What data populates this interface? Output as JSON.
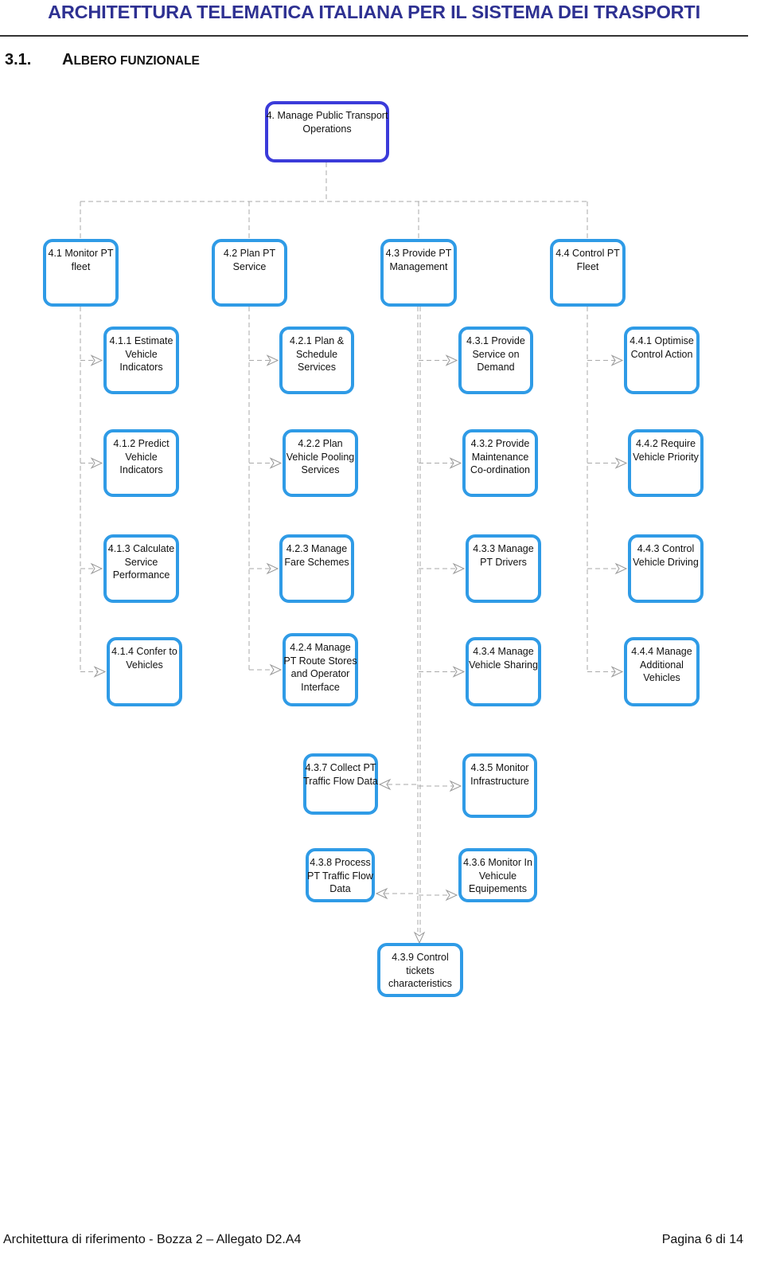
{
  "header": {
    "title": "ARCHITETTURA TELEMATICA ITALIANA PER IL SISTEMA DEI TRASPORTI"
  },
  "section": {
    "number": "3.1.",
    "title_initial": "A",
    "title_rest": "LBERO FUNZIONALE"
  },
  "colors": {
    "header_text": "#2e3192",
    "root_border": "#3b3bd9",
    "node_border": "#2f9be6",
    "connector": "#aaaaaa"
  },
  "tree": {
    "root": {
      "id": "4",
      "label": "4. Manage Public Transport Operations"
    },
    "nodes": [
      {
        "id": "4.1",
        "label": "4.1 Monitor PT fleet"
      },
      {
        "id": "4.2",
        "label": "4.2 Plan PT Service"
      },
      {
        "id": "4.3",
        "label": "4.3 Provide PT Management"
      },
      {
        "id": "4.4",
        "label": "4.4 Control PT Fleet"
      },
      {
        "id": "4.1.1",
        "label": "4.1.1 Estimate Vehicle Indicators"
      },
      {
        "id": "4.2.1",
        "label": "4.2.1 Plan & Schedule Services"
      },
      {
        "id": "4.3.1",
        "label": "4.3.1 Provide Service on Demand"
      },
      {
        "id": "4.4.1",
        "label": "4.4.1 Optimise Control Action"
      },
      {
        "id": "4.1.2",
        "label": "4.1.2 Predict Vehicle Indicators"
      },
      {
        "id": "4.2.2",
        "label": "4.2.2 Plan Vehicle Pooling Services"
      },
      {
        "id": "4.3.2",
        "label": "4.3.2 Provide Maintenance Co-ordination"
      },
      {
        "id": "4.4.2",
        "label": "4.4.2 Require Vehicle Priority"
      },
      {
        "id": "4.1.3",
        "label": "4.1.3 Calculate Service Performance"
      },
      {
        "id": "4.2.3",
        "label": "4.2.3 Manage Fare Schemes"
      },
      {
        "id": "4.3.3",
        "label": "4.3.3 Manage PT Drivers"
      },
      {
        "id": "4.4.3",
        "label": "4.4.3 Control Vehicle Driving"
      },
      {
        "id": "4.1.4",
        "label": "4.1.4 Confer to Vehicles"
      },
      {
        "id": "4.2.4",
        "label": "4.2.4 Manage PT Route Stores and Operator Interface"
      },
      {
        "id": "4.3.4",
        "label": "4.3.4 Manage Vehicle Sharing"
      },
      {
        "id": "4.4.4",
        "label": "4.4.4 Manage Additional Vehicles"
      },
      {
        "id": "4.3.7",
        "label": "4.3.7 Collect PT Traffic Flow Data"
      },
      {
        "id": "4.3.5",
        "label": "4.3.5 Monitor Infrastructure"
      },
      {
        "id": "4.3.8",
        "label": "4.3.8 Process PT Traffic Flow Data"
      },
      {
        "id": "4.3.6",
        "label": "4.3.6 Monitor In Vehicule Equipements"
      },
      {
        "id": "4.3.9",
        "label": "4.3.9 Control tickets characteristics"
      }
    ]
  },
  "footer": {
    "left": "Architettura di riferimento - Bozza 2 – Allegato D2.A4",
    "right": "Pagina 6 di 14"
  }
}
